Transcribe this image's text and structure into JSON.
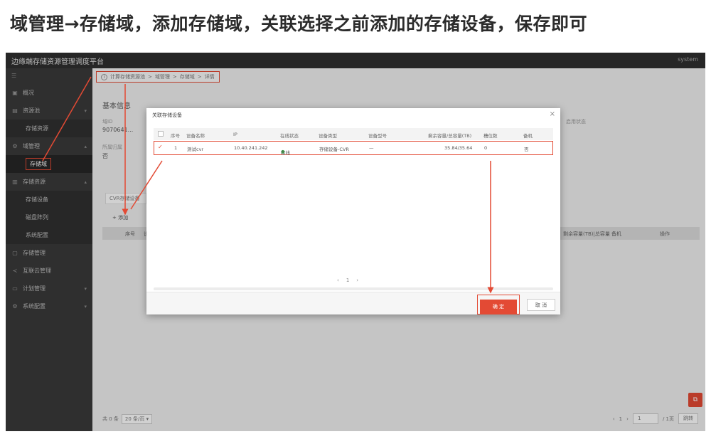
{
  "instruction": "域管理→存储域，添加存储域，关联选择之前添加的存储设备，保存即可",
  "app": {
    "title": "边缘端存储资源管理调度平台",
    "user": "system"
  },
  "sidebar": {
    "collapse": "☰",
    "items": [
      {
        "label": "概况",
        "icon": "▣"
      },
      {
        "label": "资源池",
        "icon": "▤"
      },
      {
        "label": "存储资源",
        "icon": ""
      },
      {
        "label": "域管理",
        "icon": "⚙"
      },
      {
        "label": "存储域",
        "icon": ""
      },
      {
        "label": "存储资源",
        "icon": "▥"
      },
      {
        "label": "存储设备",
        "icon": ""
      },
      {
        "label": "磁盘阵列",
        "icon": ""
      },
      {
        "label": "系统配置",
        "icon": ""
      },
      {
        "label": "存储管理",
        "icon": "▢"
      },
      {
        "label": "互联云管理",
        "icon": "≺"
      },
      {
        "label": "计划管理",
        "icon": "▭"
      },
      {
        "label": "系统配置",
        "icon": "⚙"
      }
    ]
  },
  "breadcrumb": [
    "计算存储资源池",
    "域管理",
    "存储域",
    "详情"
  ],
  "basic": {
    "title": "基本信息",
    "id_label": "域ID",
    "id_value": "9070641...",
    "desc_label": "所属归属",
    "desc_value": "否",
    "extra_label": "启用状态"
  },
  "tab_cvr": "CVR存储设备",
  "add_label": "+ 添加",
  "bg_table": {
    "headers": [
      "序号",
      "设备",
      "剩余容量(TB)|总容量",
      "备机",
      "操作"
    ]
  },
  "pagination": {
    "total": "共 0 条",
    "per_page": "20 条/页",
    "page": "1",
    "page_of": "/ 1页",
    "go": "跳转"
  },
  "float_icon": "⧉",
  "modal": {
    "title": "关联存储设备",
    "close": "×",
    "headers": [
      "序号",
      "设备名称",
      "IP",
      "在线状态",
      "设备类型",
      "设备型号",
      "剩余容量/总容量(TB)",
      "槽位数",
      "备机"
    ],
    "row": {
      "check": "✓",
      "index": "1",
      "name": "测试cvr",
      "ip": "10.40.241.242",
      "status": "在线",
      "type": "存储设备-CVR",
      "model": "—",
      "capacity": "35.84/35.64",
      "slots": "0",
      "standby": "否"
    },
    "pager": {
      "prev": "‹",
      "page": "1",
      "next": "›"
    },
    "ok": "确 定",
    "cancel": "取 消"
  }
}
